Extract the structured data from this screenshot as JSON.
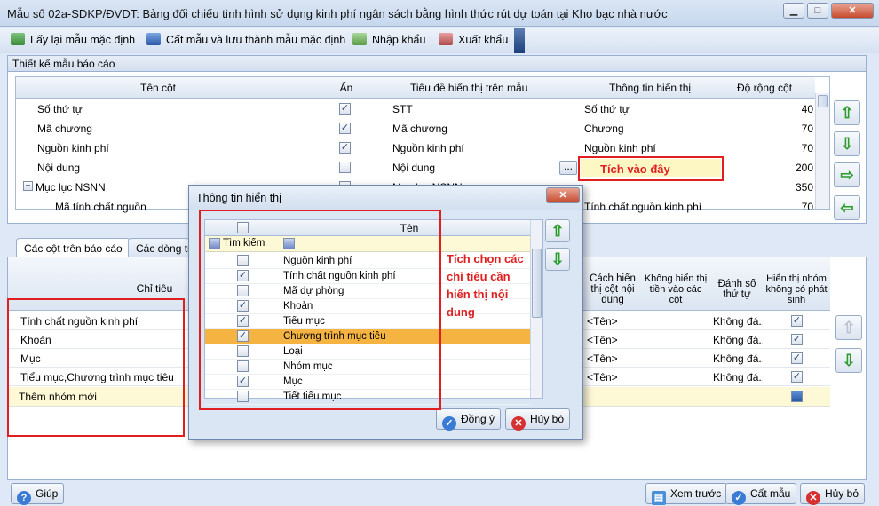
{
  "window": {
    "title": "Mẫu số 02a-SDKP/ĐVDT: Bảng đối chiếu tình hình sử dụng kinh phí ngân sách bằng hình thức rút dự toán tại Kho bạc nhà nước"
  },
  "toolbar": {
    "reset_label": "Lấy lại mẫu mặc định",
    "save_default_label": "Cất mẫu và lưu thành mẫu mặc định",
    "import_label": "Nhập khẩu",
    "export_label": "Xuất khẩu"
  },
  "design": {
    "title": "Thiết kế mẫu báo cáo",
    "headers": [
      "Tên cột",
      "Ẩn",
      "Tiêu đề hiển thị trên mẫu",
      "Thông tin hiển thị",
      "Độ rộng cột"
    ],
    "rows": [
      {
        "name": "Số thứ tự",
        "hidden": true,
        "caption": "STT",
        "info": "Số thứ tự",
        "width": "40"
      },
      {
        "name": "Mã chương",
        "hidden": true,
        "caption": "Mã chương",
        "info": "Chương",
        "width": "70"
      },
      {
        "name": "Nguồn kinh phí",
        "hidden": true,
        "caption": "Nguồn kinh phí",
        "info": "Nguồn kinh phí",
        "width": "70"
      },
      {
        "name": "Nội dung",
        "hidden": false,
        "caption": "Nội dung",
        "info": "",
        "width": "200"
      },
      {
        "name": "Mục lục NSNN",
        "hidden": false,
        "caption": "Mục lục NSNN",
        "info": "",
        "width": "350"
      },
      {
        "name": "Mã tính chất nguồn",
        "hidden": false,
        "caption": "",
        "info": "Tính chất nguồn kinh phí",
        "width": "70"
      }
    ],
    "expander": "−",
    "ellipsis": "..."
  },
  "tabs": [
    "Các cột trên báo cáo",
    "Các dòng trê"
  ],
  "lower": {
    "headers": [
      "Chỉ tiêu",
      "Cách hiển thị cột nội dung",
      "Không hiển thị tiền vào các cột",
      "Đánh số thứ tự",
      "Hiển thị nhóm không có phát sinh"
    ],
    "rows": [
      {
        "label": "Tính chất nguồn kinh phí",
        "display": "<Tên>",
        "numbering": "Không đá...",
        "show": true
      },
      {
        "label": "Khoản",
        "display": "<Tên>",
        "numbering": "Không đá...",
        "show": true
      },
      {
        "label": "Mục",
        "display": "<Tên>",
        "numbering": "Không đá...",
        "show": true
      },
      {
        "label": "Tiểu mục,Chương trình mục tiêu",
        "display": "<Tên>",
        "numbering": "Không đá...",
        "show": true
      }
    ],
    "new_group": "Thêm nhóm mới"
  },
  "dialog": {
    "title": "Thông tin hiển thị",
    "column_header": "Tên",
    "search_label": "Tìm kiếm",
    "items": [
      {
        "label": "Nguồn kinh phí",
        "checked": false
      },
      {
        "label": "Tính chất nguồn kinh phí",
        "checked": true
      },
      {
        "label": "Mã dự phòng",
        "checked": false
      },
      {
        "label": "Khoản",
        "checked": true
      },
      {
        "label": "Tiểu mục",
        "checked": true
      },
      {
        "label": "Chương trình mục tiêu",
        "checked": true
      },
      {
        "label": "Loại",
        "checked": false
      },
      {
        "label": "Nhóm mục",
        "checked": false
      },
      {
        "label": "Mục",
        "checked": true
      },
      {
        "label": "Tiết tiểu mục",
        "checked": false
      }
    ],
    "ok_label": "Đồng ý",
    "cancel_label": "Hủy bỏ"
  },
  "annotations": {
    "click_here": "Tích vào đây",
    "select_items": "Tích chọn các chỉ tiêu cần hiển thị nội dung"
  },
  "footer": {
    "help_label": "Giúp",
    "preview_label": "Xem trước",
    "save_label": "Cất mẫu",
    "cancel_label": "Hủy bỏ"
  },
  "colors": {
    "highlight_row": "#f5b342",
    "info_cell": "#fdf7c4",
    "new_group_row": "#fdf8d6",
    "annotation_red": "#e02020"
  }
}
